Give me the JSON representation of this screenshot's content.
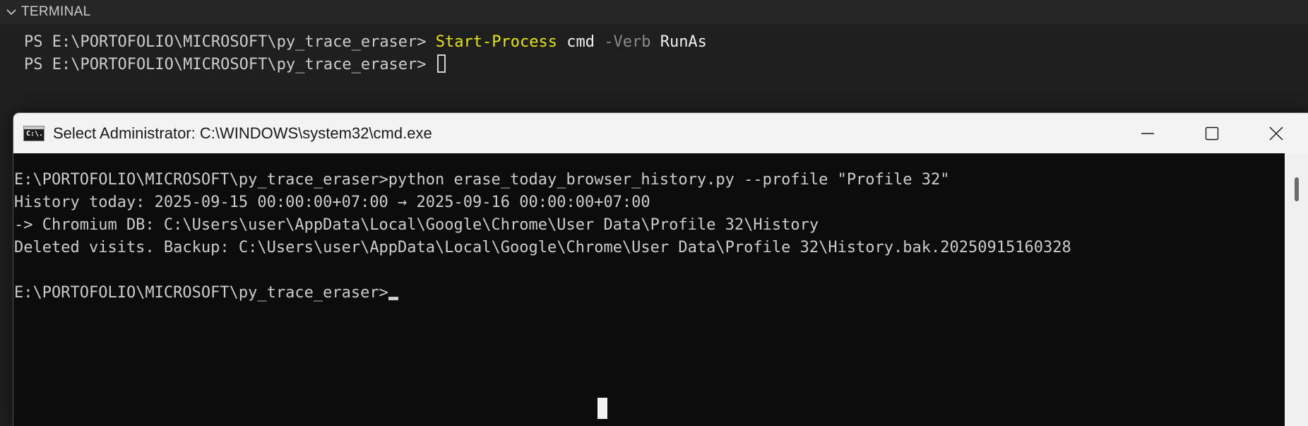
{
  "terminal": {
    "panel_title": "TERMINAL",
    "lines": [
      {
        "prompt": "PS E:\\PORTOFOLIO\\MICROSOFT\\py_trace_eraser> ",
        "cmdlet": "Start-Process",
        "arg1": " cmd ",
        "param": "-Verb",
        "arg2": " RunAs"
      },
      {
        "prompt": "PS E:\\PORTOFOLIO\\MICROSOFT\\py_trace_eraser> "
      }
    ],
    "colors": {
      "cmdlet": "#e5e510",
      "param": "#8a8a8a"
    }
  },
  "cmd_window": {
    "title": "Select Administrator: C:\\WINDOWS\\system32\\cmd.exe",
    "icon": "cmd-app-icon",
    "icon_text": "C:\\.",
    "controls": [
      "minimize-icon",
      "maximize-icon",
      "close-icon"
    ],
    "output": [
      "E:\\PORTOFOLIO\\MICROSOFT\\py_trace_eraser>python erase_today_browser_history.py --profile \"Profile 32\"",
      "History today: 2025-09-15 00:00:00+07:00 → 2025-09-16 00:00:00+07:00",
      "-> Chromium DB: C:\\Users\\user\\AppData\\Local\\Google\\Chrome\\User Data\\Profile 32\\History",
      "Deleted visits. Backup: C:\\Users\\user\\AppData\\Local\\Google\\Chrome\\User Data\\Profile 32\\History.bak.20250915160328",
      "",
      "E:\\PORTOFOLIO\\MICROSOFT\\py_trace_eraser>"
    ]
  }
}
